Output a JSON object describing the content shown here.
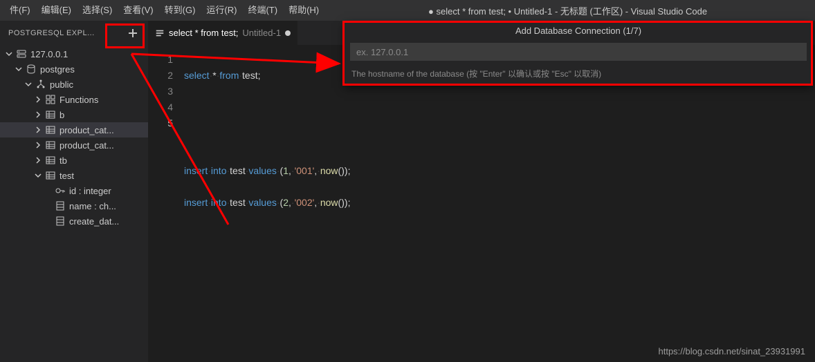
{
  "menubar": {
    "items": [
      "件(F)",
      "编辑(E)",
      "选择(S)",
      "查看(V)",
      "转到(G)",
      "运行(R)",
      "终端(T)",
      "帮助(H)"
    ],
    "title": "● select * from test; • Untitled-1 - 无标题 (工作区) - Visual Studio Code"
  },
  "sidebar": {
    "panel_title": "POSTGRESQL EXPL...",
    "add_icon": "plus-icon",
    "tree": [
      {
        "depth": 0,
        "expand": "down",
        "icon": "server",
        "label": "127.0.0.1"
      },
      {
        "depth": 1,
        "expand": "down",
        "icon": "database",
        "label": "postgres"
      },
      {
        "depth": 2,
        "expand": "down",
        "icon": "schema",
        "label": "public"
      },
      {
        "depth": 3,
        "expand": "right",
        "icon": "functions",
        "label": "Functions"
      },
      {
        "depth": 3,
        "expand": "right",
        "icon": "table",
        "label": "b"
      },
      {
        "depth": 3,
        "expand": "right",
        "icon": "table",
        "label": "product_cat...",
        "selected": true
      },
      {
        "depth": 3,
        "expand": "right",
        "icon": "table",
        "label": "product_cat..."
      },
      {
        "depth": 3,
        "expand": "right",
        "icon": "table",
        "label": "tb"
      },
      {
        "depth": 3,
        "expand": "down",
        "icon": "table",
        "label": "test"
      },
      {
        "depth": 4,
        "expand": "none",
        "icon": "key",
        "label": "id : integer"
      },
      {
        "depth": 4,
        "expand": "none",
        "icon": "column",
        "label": "name : ch..."
      },
      {
        "depth": 4,
        "expand": "none",
        "icon": "column",
        "label": "create_dat..."
      }
    ]
  },
  "tabs": {
    "main": {
      "name": "select * from test;",
      "secondary": "Untitled-1",
      "dirty": true
    }
  },
  "code": {
    "lines": [
      "1",
      "2",
      "3",
      "4",
      "5"
    ],
    "l1": {
      "kw1": "select",
      "star": "*",
      "kw2": "from",
      "ident": "test",
      "semi": ";"
    },
    "l4": {
      "kw1": "insert",
      "kw2": "into",
      "ident": "test",
      "kw3": "values",
      "lp": "(",
      "n1": "1",
      "c1": ",",
      "s1": "'001'",
      "c2": ",",
      "fn": "now",
      "lp2": "(",
      "rp2": ")",
      "rp": ")",
      "semi": ";"
    },
    "l5": {
      "kw1": "insert",
      "kw2": "into",
      "ident": "test",
      "kw3": "values",
      "lp": "(",
      "n1": "2",
      "c1": ",",
      "s1": "'002'",
      "c2": ",",
      "fn": "now",
      "lp2": "(",
      "rp2": ")",
      "rp": ")",
      "semi": ";"
    }
  },
  "quick_input": {
    "title": "Add Database Connection (1/7)",
    "placeholder": "ex. 127.0.0.1",
    "hint": "The hostname of the database (按 \"Enter\" 以确认或按 \"Esc\" 以取消)"
  },
  "watermark": "https://blog.csdn.net/sinat_23931991"
}
